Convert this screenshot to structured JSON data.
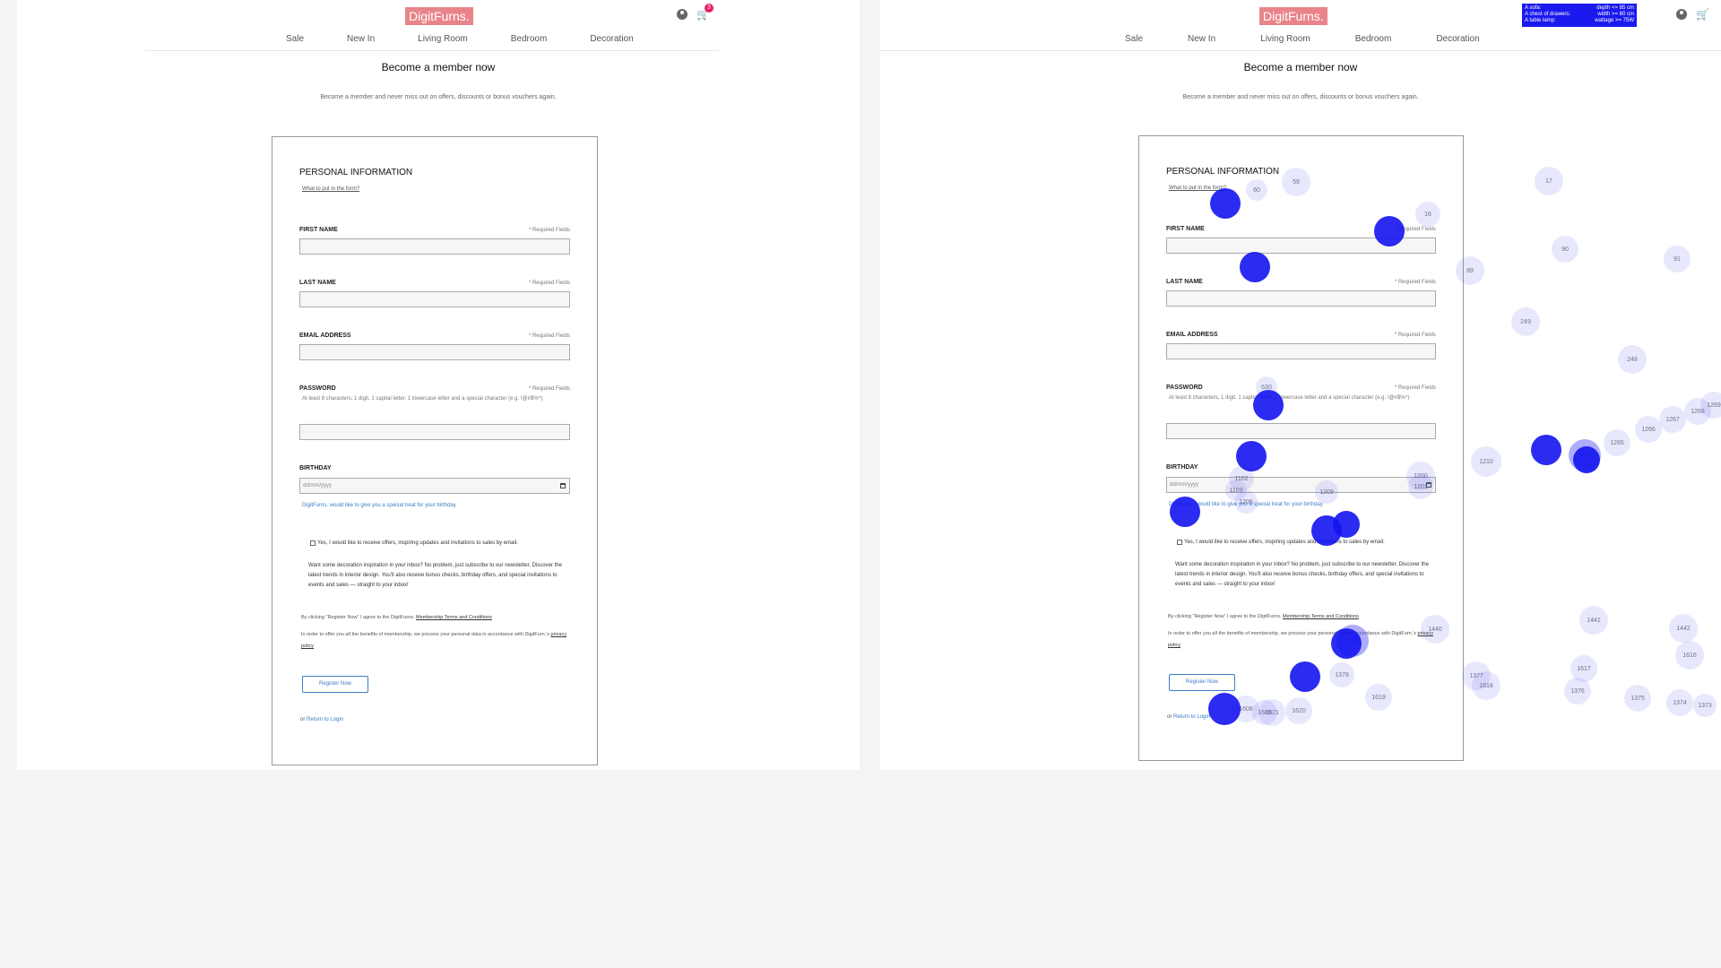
{
  "brand": {
    "logo_text": "DigitFurns.",
    "logo_color": "#e9848a"
  },
  "header": {
    "cart_count": "3",
    "badge_color": "#e91e63"
  },
  "nav": {
    "items": [
      "Sale",
      "New In",
      "Living Room",
      "Bedroom",
      "Decoration"
    ]
  },
  "page": {
    "title": "Become a member now",
    "subtitle": "Become a member and never miss out on offers, discounts or bonus vouchers again."
  },
  "form": {
    "section_title": "PERSONAL INFORMATION",
    "help_link": "What to put in the form?",
    "required_label": "* Required Fields",
    "first_name_label": "FIRST NAME",
    "last_name_label": "LAST NAME",
    "email_label": "EMAIL ADDRESS",
    "password_label": "PASSWORD",
    "password_hint": "At least 8 characters, 1 digit, 1 capital letter, 1 lowercase letter and a special character (e.g. !@#$%^)",
    "birthday_label": "BIRTHDAY",
    "birthday_placeholder": "dd/mm/yyyy",
    "birthday_note": "DigitFurns. would like to give you a special treat for your birthday",
    "newsletter_checkbox": "Yes, I would like to receive offers, inspiring updates and invitations to sales by email.",
    "newsletter_text": "Want some decoration inspiration in your inbox? No problem, just subscribe to our newsletter. Discover the latest trends in interior design. You'll also receive bonus checks, birthday offers, and special invitations to events and sales — straight to your inbox!",
    "terms_prefix": "By clicking \"Register Now\" I agree to the DigitFurns.",
    "terms_link": "Membership Terms and Conditions",
    "privacy_prefix": "In order to offer you all the benefits of membership, we process your personal data in accordance with DigitFurn.'s",
    "privacy_link": "privacy policy",
    "register_button": "Register Now",
    "or_text": "or",
    "return_link": "Return to Login",
    "accent_color": "#3b7dc4"
  },
  "task_legend": [
    {
      "item": "A sofa:",
      "constraint": "depth <= 85 cm"
    },
    {
      "item": "A chest of drawers:",
      "constraint": "width >= 80 cm"
    },
    {
      "item": "A table lamp:",
      "constraint": "wattage >= 75W"
    }
  ],
  "fixation_labels": [
    "59",
    "60",
    "16",
    "17",
    "90",
    "91",
    "89",
    "249",
    "248",
    "630",
    "1102",
    "1103",
    "1200",
    "1201",
    "1206",
    "1209",
    "1210",
    "1265",
    "1266",
    "1267",
    "1268",
    "1269",
    "1376",
    "1377",
    "1378",
    "1375",
    "1374",
    "1373",
    "1440",
    "1441",
    "1442",
    "1616",
    "1617",
    "1618",
    "1619",
    "1620",
    "1621",
    "1438",
    "1439",
    "1608",
    "1609"
  ]
}
